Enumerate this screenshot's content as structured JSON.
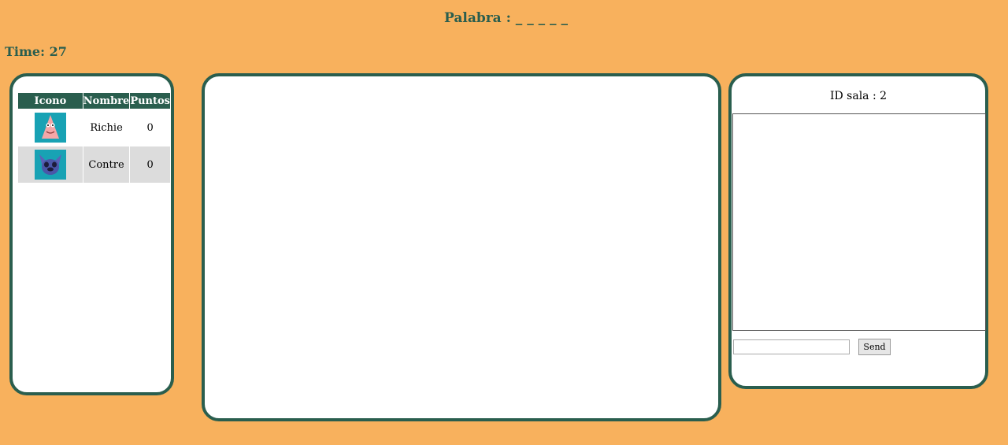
{
  "header": {
    "word_label": "Palabra : _ _ _ _ _",
    "time_label": "Time: 27"
  },
  "scoreboard": {
    "columns": [
      "Icono",
      "Nombre",
      "Puntos"
    ],
    "rows": [
      {
        "icon": "pink-starfish-avatar-icon",
        "name": "Richie",
        "points": "0"
      },
      {
        "icon": "blue-alien-avatar-icon",
        "name": "Contre",
        "points": "0"
      }
    ]
  },
  "chat": {
    "room_label": "ID sala : 2",
    "input_value": "",
    "send_label": "Send"
  },
  "colors": {
    "background": "#f8b15d",
    "accent": "#2a5e4e",
    "avatar_bg": "#18a2b4"
  }
}
